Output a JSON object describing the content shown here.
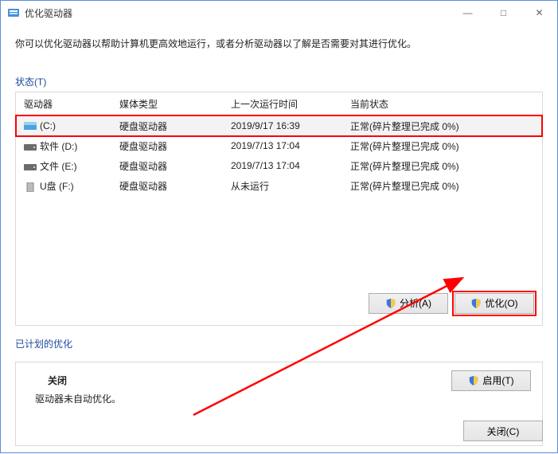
{
  "window": {
    "title": "优化驱动器",
    "minimize": "—",
    "maximize": "□",
    "close": "✕"
  },
  "intro": "你可以优化驱动器以帮助计算机更高效地运行，或者分析驱动器以了解是否需要对其进行优化。",
  "status_label": "状态(T)",
  "columns": {
    "drive": "驱动器",
    "media": "媒体类型",
    "last_run": "上一次运行时间",
    "status": "当前状态"
  },
  "rows": [
    {
      "icon": "drive-c",
      "name": "(C:)",
      "media": "硬盘驱动器",
      "last": "2019/9/17 16:39",
      "status": "正常(碎片整理已完成 0%)",
      "selected": true,
      "highlight": true
    },
    {
      "icon": "drive-d",
      "name": "软件 (D:)",
      "media": "硬盘驱动器",
      "last": "2019/7/13 17:04",
      "status": "正常(碎片整理已完成 0%)"
    },
    {
      "icon": "drive-e",
      "name": "文件 (E:)",
      "media": "硬盘驱动器",
      "last": "2019/7/13 17:04",
      "status": "正常(碎片整理已完成 0%)"
    },
    {
      "icon": "drive-f",
      "name": "U盘 (F:)",
      "media": "硬盘驱动器",
      "last": "从未运行",
      "status": "正常(碎片整理已完成 0%)"
    }
  ],
  "buttons": {
    "analyze": "分析(A)",
    "optimize": "优化(O)",
    "enable": "启用(T)",
    "close": "关闭(C)"
  },
  "scheduled_label": "已计划的优化",
  "scheduled": {
    "state": "关闭",
    "desc": "驱动器未自动优化。"
  },
  "annotation": {
    "color": "#ff0000"
  }
}
